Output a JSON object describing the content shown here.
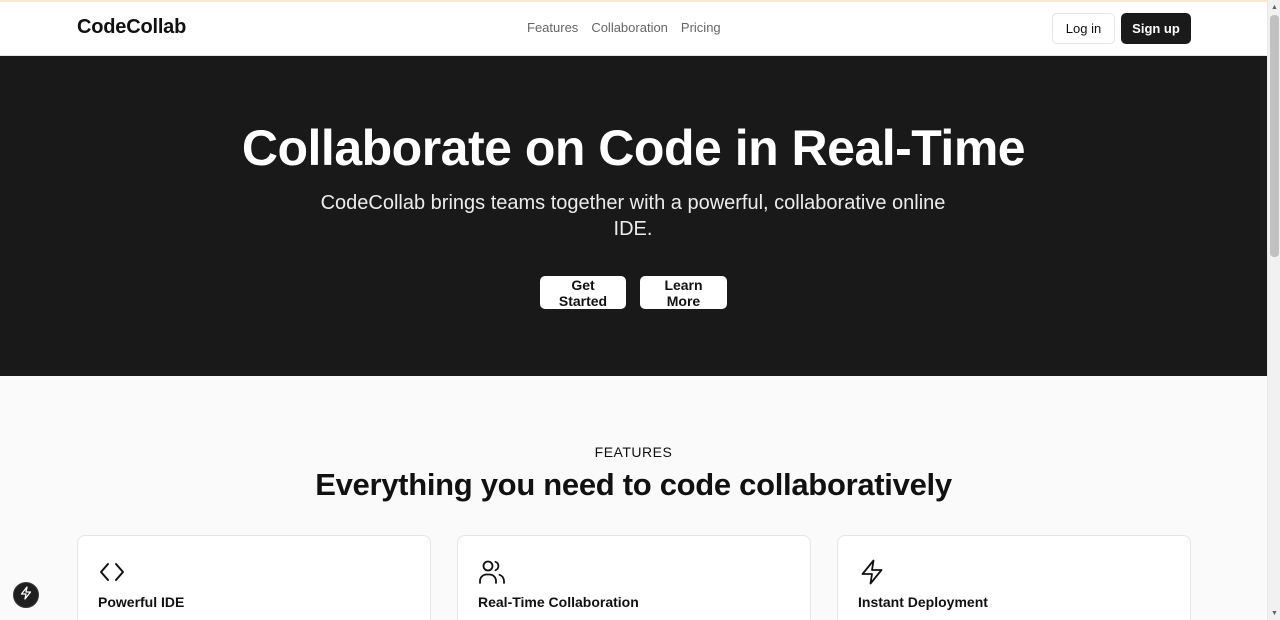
{
  "header": {
    "logo": "CodeCollab",
    "nav": [
      "Features",
      "Collaboration",
      "Pricing"
    ],
    "login_label": "Log in",
    "signup_label": "Sign up"
  },
  "hero": {
    "title": "Collaborate on Code in Real-Time",
    "subtitle": "CodeCollab brings teams together with a powerful, collaborative online IDE.",
    "primary_cta": "Get Started",
    "secondary_cta": "Learn More"
  },
  "features": {
    "eyebrow": "FEATURES",
    "title": "Everything you need to code collaboratively",
    "cards": [
      {
        "icon": "code-icon",
        "title": "Powerful IDE"
      },
      {
        "icon": "users-icon",
        "title": "Real-Time Collaboration"
      },
      {
        "icon": "lightning-icon",
        "title": "Instant Deployment"
      }
    ]
  },
  "floating_badge": {
    "icon": "lightning-icon"
  },
  "colors": {
    "hero_background": "#191919",
    "primary_button": "#1a1a1a",
    "page_background": "#fafafa"
  }
}
